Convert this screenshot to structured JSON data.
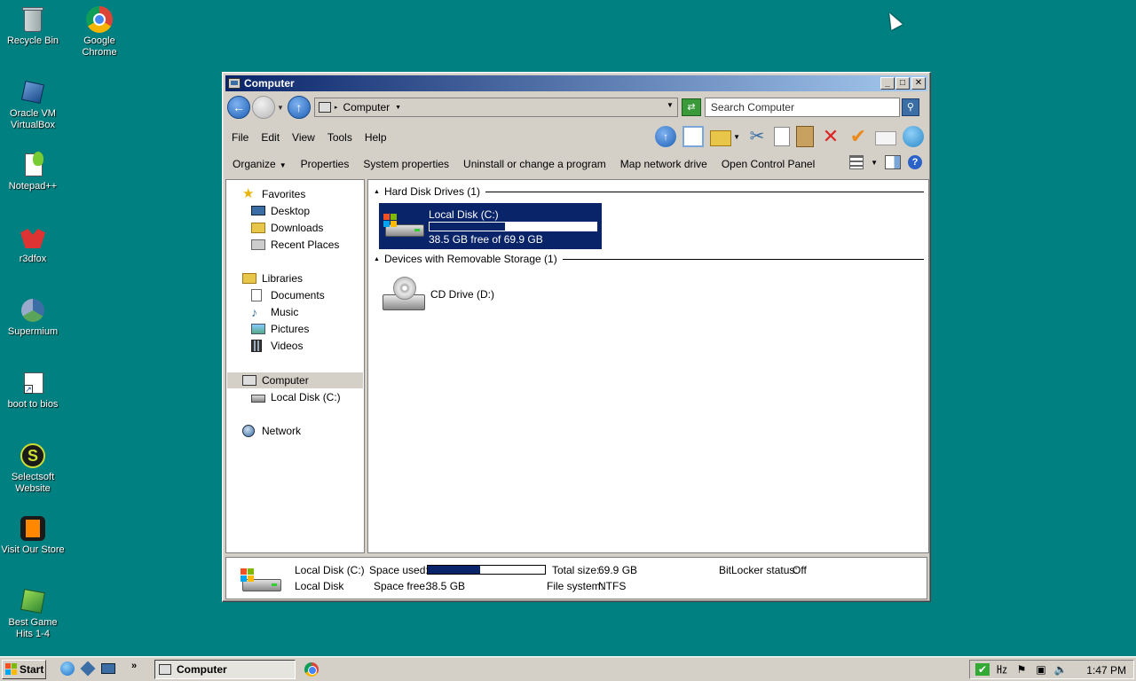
{
  "desktop": {
    "icons": [
      {
        "label": "Recycle Bin",
        "icon": "recycle-bin-icon"
      },
      {
        "label": "Google Chrome",
        "icon": "chrome-icon"
      },
      {
        "label": "Oracle VM VirtualBox",
        "icon": "virtualbox-icon"
      },
      {
        "label": "Notepad++",
        "icon": "notepad-plus-plus-icon"
      },
      {
        "label": "r3dfox",
        "icon": "r3dfox-icon"
      },
      {
        "label": "Supermium",
        "icon": "supermium-icon"
      },
      {
        "label": "boot to bios",
        "icon": "shortcut-icon"
      },
      {
        "label": "Selectsoft Website",
        "icon": "selectsoft-icon"
      },
      {
        "label": "Visit Our Store",
        "icon": "store-icon"
      },
      {
        "label": "Best Game Hits 1-4",
        "icon": "games-icon"
      }
    ]
  },
  "window": {
    "title": "Computer",
    "address": "Computer",
    "search_placeholder": "Search Computer",
    "menu": [
      "File",
      "Edit",
      "View",
      "Tools",
      "Help"
    ],
    "commands": {
      "organize": "Organize",
      "properties": "Properties",
      "system_properties": "System properties",
      "uninstall": "Uninstall or change a program",
      "map_drive": "Map network drive",
      "control_panel": "Open Control Panel"
    },
    "nav": {
      "favorites": "Favorites",
      "desktop": "Desktop",
      "downloads": "Downloads",
      "recent": "Recent Places",
      "libraries": "Libraries",
      "documents": "Documents",
      "music": "Music",
      "pictures": "Pictures",
      "videos": "Videos",
      "computer": "Computer",
      "local_disk": "Local Disk (C:)",
      "network": "Network"
    },
    "content": {
      "hdd_group": "Hard Disk Drives (1)",
      "removable_group": "Devices with Removable Storage (1)",
      "local_disk_name": "Local Disk (C:)",
      "local_disk_free": "38.5 GB free of 69.9 GB",
      "local_disk_used_fraction": 0.45,
      "cd_name": "CD Drive (D:)"
    },
    "details": {
      "name": "Local Disk (C:)",
      "type": "Local Disk",
      "space_used_label": "Space used:",
      "space_free_label": "Space free:",
      "space_free_value": "38.5 GB",
      "total_size_label": "Total size:",
      "total_size_value": "69.9 GB",
      "file_system_label": "File system:",
      "file_system_value": "NTFS",
      "bitlocker_label": "BitLocker status:",
      "bitlocker_value": "Off",
      "used_fraction": 0.45
    }
  },
  "taskbar": {
    "start_label": "Start",
    "task_label": "Computer",
    "clock": "1:47 PM"
  },
  "colors": {
    "desktop": "#008080",
    "selection": "#0a246a",
    "titlebar_start": "#0a246a",
    "titlebar_end": "#a6caf0"
  }
}
